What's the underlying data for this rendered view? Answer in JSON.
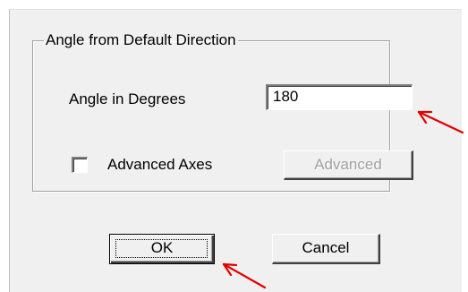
{
  "group": {
    "legend": "Angle from Default Direction"
  },
  "angle": {
    "label": "Angle in Degrees",
    "value": "180"
  },
  "advanced_axes": {
    "label": "Advanced Axes",
    "checked": false
  },
  "buttons": {
    "advanced": "Advanced",
    "ok": "OK",
    "cancel": "Cancel"
  },
  "annotation": {
    "arrow_color": "#e00000"
  }
}
